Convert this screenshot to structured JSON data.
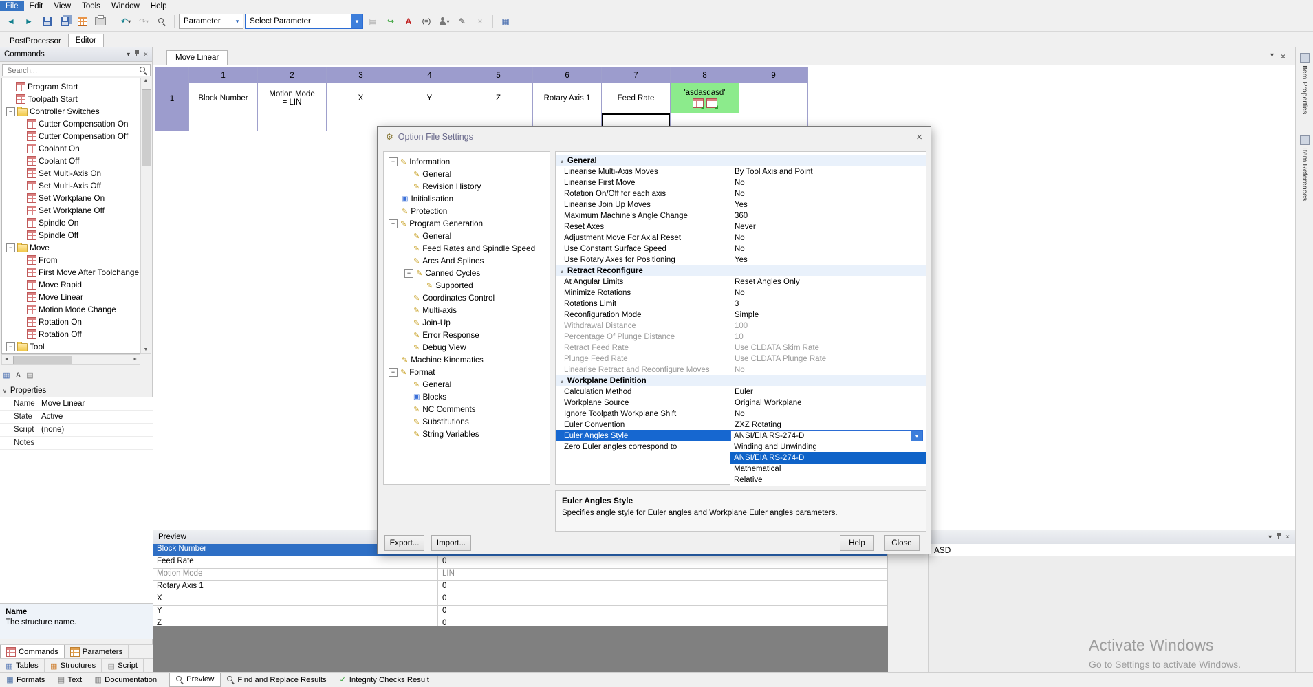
{
  "icons": {
    "minus": "−",
    "plus": "+",
    "tri_down": "▾",
    "chevron": "∨",
    "close": "×",
    "nav_back": "◄",
    "nav_forward": "►",
    "undo": "↶",
    "redo": "↷",
    "insert_arrow": "↪",
    "edit_pencil": "✎",
    "letter_a": "A",
    "equals": "(=)",
    "table": "▦",
    "page": "▤",
    "book": "▥",
    "arrow_up": "▲",
    "arrow_down": "▼",
    "arrow_left": "◄",
    "arrow_right": "►",
    "gear": "⚙",
    "tree_page": "✎",
    "init_box": "▣",
    "check": "✓"
  },
  "menubar": {
    "items": [
      "File",
      "Edit",
      "View",
      "Tools",
      "Window",
      "Help"
    ]
  },
  "toolbar": {
    "parameter_combo": "Parameter",
    "select_parameter_combo": "Select Parameter"
  },
  "app_tabs": {
    "postprocessor": "PostProcessor",
    "editor": "Editor"
  },
  "commands_panel": {
    "title": "Commands",
    "search_placeholder": "Search...",
    "tree": [
      "Program Start",
      "Toolpath Start",
      "Controller Switches",
      "Cutter Compensation On",
      "Cutter Compensation Off",
      "Coolant On",
      "Coolant Off",
      "Set Multi-Axis On",
      "Set Multi-Axis Off",
      "Set Workplane On",
      "Set Workplane Off",
      "Spindle On",
      "Spindle Off",
      "Move",
      "From",
      "First Move After Toolchange",
      "Move Rapid",
      "Move Linear",
      "Motion Mode Change",
      "Rotation On",
      "Rotation Off",
      "Tool"
    ]
  },
  "properties_panel": {
    "title": "Properties",
    "rows": [
      {
        "label": "Name",
        "value": "Move Linear"
      },
      {
        "label": "State",
        "value": "Active"
      },
      {
        "label": "Script",
        "value": "(none)"
      },
      {
        "label": "Notes",
        "value": ""
      }
    ],
    "description_title": "Name",
    "description_text": "The structure name."
  },
  "left_tab_rows": {
    "row1": [
      "Commands",
      "Parameters"
    ],
    "row2": [
      "Tables",
      "Structures",
      "Script"
    ]
  },
  "editor": {
    "tab": "Move Linear",
    "grid": {
      "columns": [
        "1",
        "2",
        "3",
        "4",
        "5",
        "6",
        "7",
        "8",
        "9"
      ],
      "row_header": "1",
      "cells": [
        "Block Number",
        "Motion Mode\n= LIN",
        "X",
        "Y",
        "Z",
        "Rotary Axis 1",
        "Feed Rate",
        "'asdasdasd'",
        ""
      ]
    }
  },
  "dialog": {
    "title": "Option File Settings",
    "tree": [
      "Information",
      "General",
      "Revision History",
      "Initialisation",
      "Protection",
      "Program Generation",
      "General",
      "Feed Rates and Spindle Speed",
      "Arcs And Splines",
      "Canned Cycles",
      "Supported",
      "Coordinates Control",
      "Multi-axis",
      "Join-Up",
      "Error Response",
      "Debug View",
      "Machine Kinematics",
      "Format",
      "General",
      "Blocks",
      "NC Comments",
      "Substitutions",
      "String Variables"
    ],
    "sections": [
      {
        "title": "General",
        "rows": [
          {
            "label": "Linearise Multi-Axis Moves",
            "value": "By Tool Axis and Point"
          },
          {
            "label": "Linearise First Move",
            "value": "No"
          },
          {
            "label": "Rotation On/Off for each axis",
            "value": "No"
          },
          {
            "label": "Linearise Join Up Moves",
            "value": "Yes"
          },
          {
            "label": "Maximum Machine's Angle Change",
            "value": "360"
          },
          {
            "label": "Reset Axes",
            "value": "Never"
          },
          {
            "label": "Adjustment Move For Axial Reset",
            "value": "No"
          },
          {
            "label": "Use Constant Surface Speed",
            "value": "No"
          },
          {
            "label": "Use Rotary Axes for Positioning",
            "value": "Yes"
          }
        ]
      },
      {
        "title": "Retract Reconfigure",
        "rows": [
          {
            "label": "At Angular Limits",
            "value": "Reset Angles Only"
          },
          {
            "label": "Minimize Rotations",
            "value": "No"
          },
          {
            "label": "Rotations Limit",
            "value": "3"
          },
          {
            "label": "Reconfiguration Mode",
            "value": "Simple"
          },
          {
            "label": "Withdrawal Distance",
            "value": "100"
          },
          {
            "label": "Percentage Of Plunge Distance",
            "value": "10"
          },
          {
            "label": "Retract Feed Rate",
            "value": "Use CLDATA Skim Rate"
          },
          {
            "label": "Plunge Feed Rate",
            "value": "Use CLDATA Plunge Rate"
          },
          {
            "label": "Linearise Retract and Reconfigure Moves",
            "value": "No"
          }
        ]
      },
      {
        "title": "Workplane Definition",
        "rows": [
          {
            "label": "Calculation Method",
            "value": "Euler"
          },
          {
            "label": "Workplane Source",
            "value": "Original Workplane"
          },
          {
            "label": "Ignore Toolpath Workplane Shift",
            "value": "No"
          },
          {
            "label": "Euler Convention",
            "value": "ZXZ Rotating"
          },
          {
            "label": "Euler Angles Style",
            "value": "ANSI/EIA RS-274-D"
          },
          {
            "label": "Zero Euler angles correspond to",
            "value": ""
          }
        ]
      }
    ],
    "combo_value": "ANSI/EIA RS-274-D",
    "dropdown_options": [
      "Winding and Unwinding",
      "ANSI/EIA RS-274-D",
      "Mathematical",
      "Relative"
    ],
    "description": {
      "title": "Euler Angles Style",
      "text": "Specifies angle style for Euler angles and Workplane Euler angles parameters."
    },
    "buttons": {
      "export": "Export...",
      "import": "Import...",
      "help": "Help",
      "close": "Close"
    }
  },
  "preview_panel": {
    "title": "Preview",
    "rows": [
      {
        "name": "Block Number",
        "value": ""
      },
      {
        "name": "Feed Rate",
        "value": "0"
      },
      {
        "name": "Motion Mode",
        "value": "LIN"
      },
      {
        "name": "Rotary Axis 1",
        "value": "0"
      },
      {
        "name": "X",
        "value": "0"
      },
      {
        "name": "Y",
        "value": "0"
      },
      {
        "name": "Z",
        "value": "0"
      }
    ],
    "output_text": "ASD"
  },
  "bottom_tabs": {
    "left": [
      "Formats",
      "Text",
      "Documentation"
    ],
    "main": [
      "Preview",
      "Find and Replace Results",
      "Integrity Checks Result"
    ]
  },
  "right_strip": {
    "tabs": [
      "Item Properties",
      "Item References"
    ]
  },
  "watermark": {
    "line1": "Activate Windows",
    "line2": "Go to Settings to activate Windows."
  }
}
